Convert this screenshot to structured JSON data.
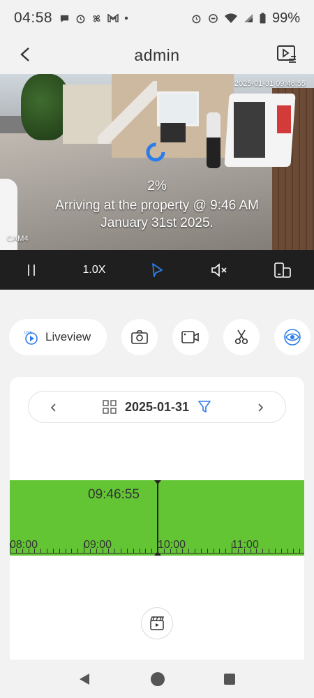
{
  "status_bar": {
    "time": "04:58",
    "battery": "99%",
    "left_icons": [
      "chat-icon",
      "alarm-icon",
      "fan-icon",
      "gmail-icon",
      "dot-icon"
    ],
    "right_icons": [
      "alarm-icon",
      "dnd-icon",
      "wifi-icon",
      "signal-icon",
      "battery-icon"
    ]
  },
  "header": {
    "title": "admin",
    "back_icon": "chevron-left-icon",
    "playlist_icon": "playlist-icon"
  },
  "video": {
    "timestamp": "2025-01-31 09:46:55",
    "progress": "2%",
    "caption_line1": "Arriving at the property @ 9:46 AM",
    "caption_line2": "January 31st 2025.",
    "camera_name": "CAM4"
  },
  "controls": {
    "zoom": "1.0X",
    "items": [
      "pause-icon",
      "zoom-text",
      "play-icon",
      "mute-icon",
      "rotate-screen-icon"
    ]
  },
  "toolbar": {
    "liveview_label": "Liveview",
    "live_badge": "LIVE",
    "tools": [
      "camera-icon",
      "video-record-icon",
      "scissors-icon",
      "eye-icon"
    ]
  },
  "date_bar": {
    "date": "2025-01-31",
    "grid_icon": "grid-icon",
    "filter_icon": "filter-icon"
  },
  "timeline": {
    "current_time": "09:46:55",
    "hours": [
      "08:00",
      "09:00",
      "10:00",
      "11:00"
    ]
  },
  "colors": {
    "accent": "#2b7de9",
    "timeline_green": "#63c534",
    "controls_bg": "#1f1f1f"
  }
}
